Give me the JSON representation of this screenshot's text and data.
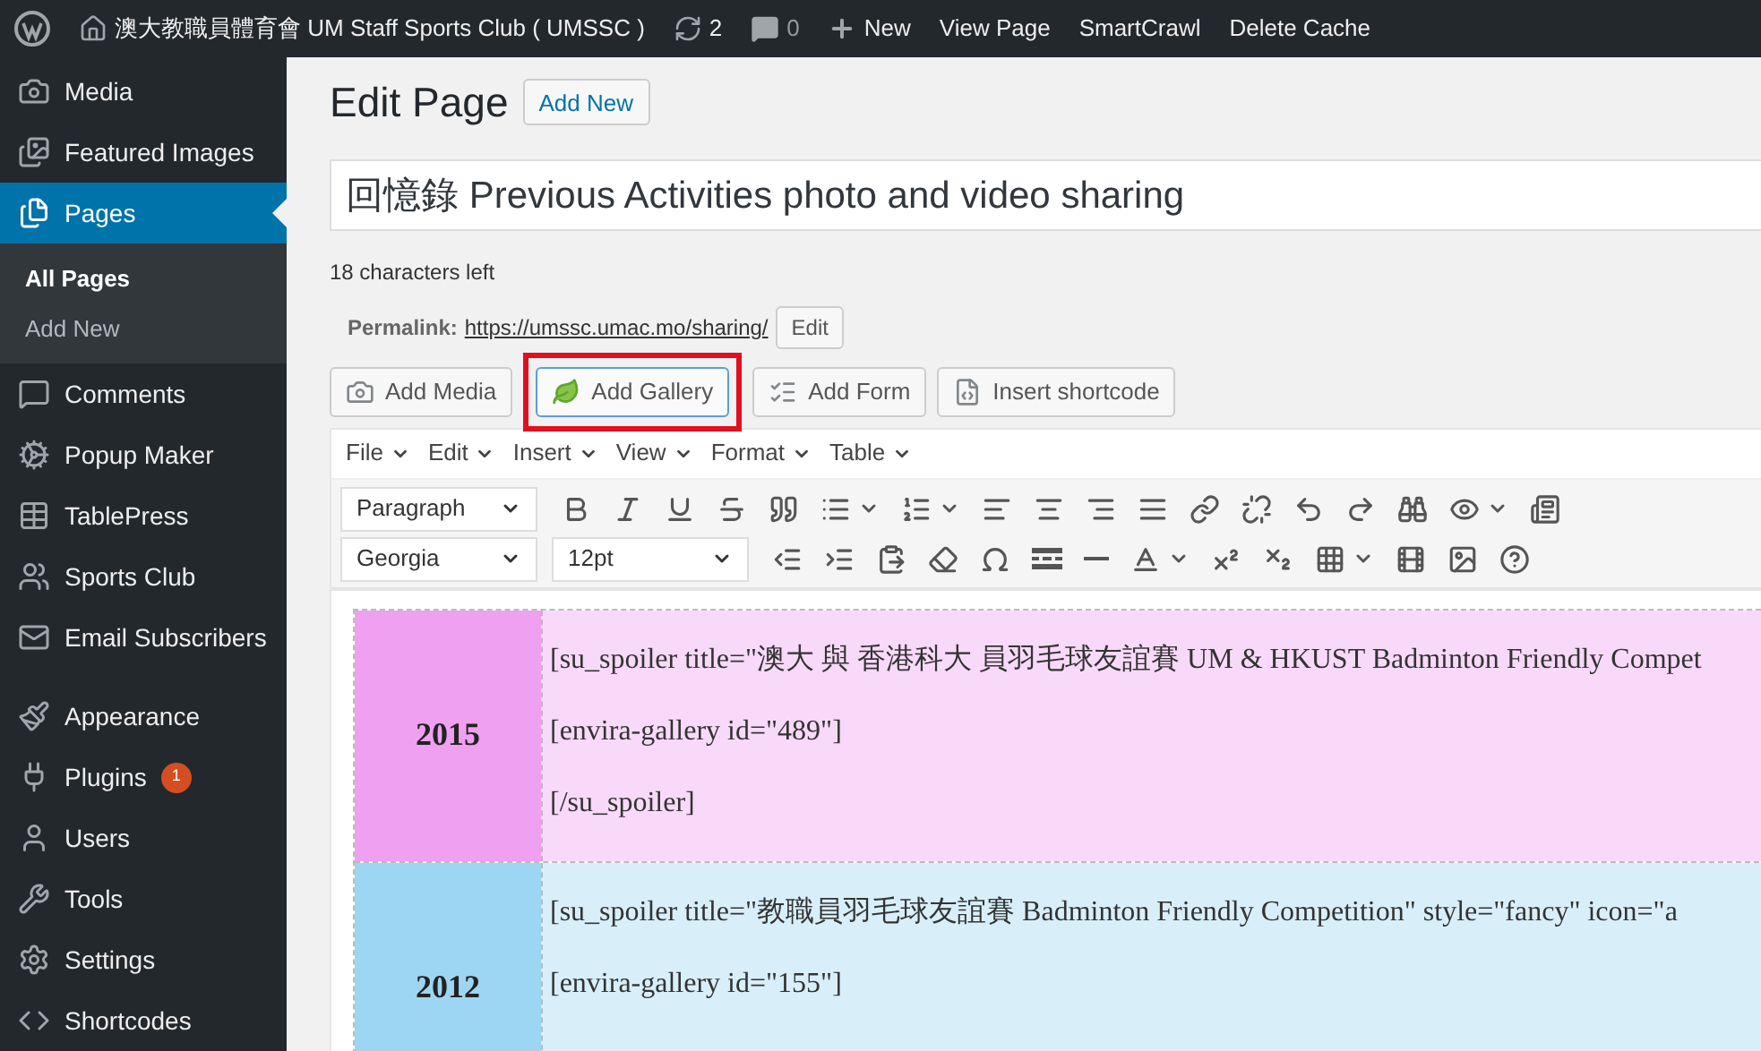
{
  "admin_bar": {
    "site": "澳大教職員體育會 UM Staff Sports Club ( UMSSC )",
    "updates": "2",
    "comments": "0",
    "new": "New",
    "links": [
      "View Page",
      "SmartCrawl",
      "Delete Cache"
    ]
  },
  "sidebar": {
    "items": [
      {
        "label": "Media",
        "selected": false
      },
      {
        "label": "Featured Images",
        "selected": false
      },
      {
        "label": "Pages",
        "selected": true,
        "children": [
          {
            "label": "All Pages",
            "selected": true
          },
          {
            "label": "Add New",
            "selected": false
          }
        ]
      },
      {
        "label": "Comments",
        "selected": false
      },
      {
        "label": "Popup Maker",
        "selected": false
      },
      {
        "label": "TablePress",
        "selected": false
      },
      {
        "label": "Sports Club",
        "selected": false
      },
      {
        "label": "Email Subscribers",
        "selected": false
      },
      {
        "label": "Appearance",
        "selected": false
      },
      {
        "label": "Plugins",
        "selected": false,
        "badge": "1"
      },
      {
        "label": "Users",
        "selected": false
      },
      {
        "label": "Tools",
        "selected": false
      },
      {
        "label": "Settings",
        "selected": false
      },
      {
        "label": "Shortcodes",
        "selected": false
      }
    ]
  },
  "heading": "Edit Page",
  "add_new": "Add New",
  "title_value": "回憶錄 Previous Activities photo and video sharing",
  "chars_left": "18 characters left",
  "permalink": {
    "label": "Permalink:",
    "url": "https://umssc.umac.mo/sharing/",
    "edit": "Edit"
  },
  "media_buttons": [
    {
      "label": "Add Media",
      "highlighted": false
    },
    {
      "label": "Add Gallery",
      "highlighted": true
    },
    {
      "label": "Add Form",
      "highlighted": false
    },
    {
      "label": "Insert shortcode",
      "highlighted": false
    }
  ],
  "menus": [
    "File",
    "Edit",
    "Insert",
    "View",
    "Format",
    "Table"
  ],
  "format_select": "Paragraph",
  "font_select": "Georgia",
  "size_select": "12pt",
  "rows": [
    {
      "year": "2015",
      "color": "#f0a0f0",
      "lines": [
        "[su_spoiler title=\"澳大 與 香港科大 員羽毛球友誼賽 UM & HKUST Badminton Friendly Compet",
        "[envira-gallery id=\"489\"]",
        "[/su_spoiler]"
      ]
    },
    {
      "year": "2012",
      "color": "#9dd6f2",
      "lines": [
        "[su_spoiler title=\"教職員羽毛球友誼賽 Badminton Friendly Competition\" style=\"fancy\" icon=\"a",
        "[envira-gallery id=\"155\"]"
      ]
    }
  ]
}
